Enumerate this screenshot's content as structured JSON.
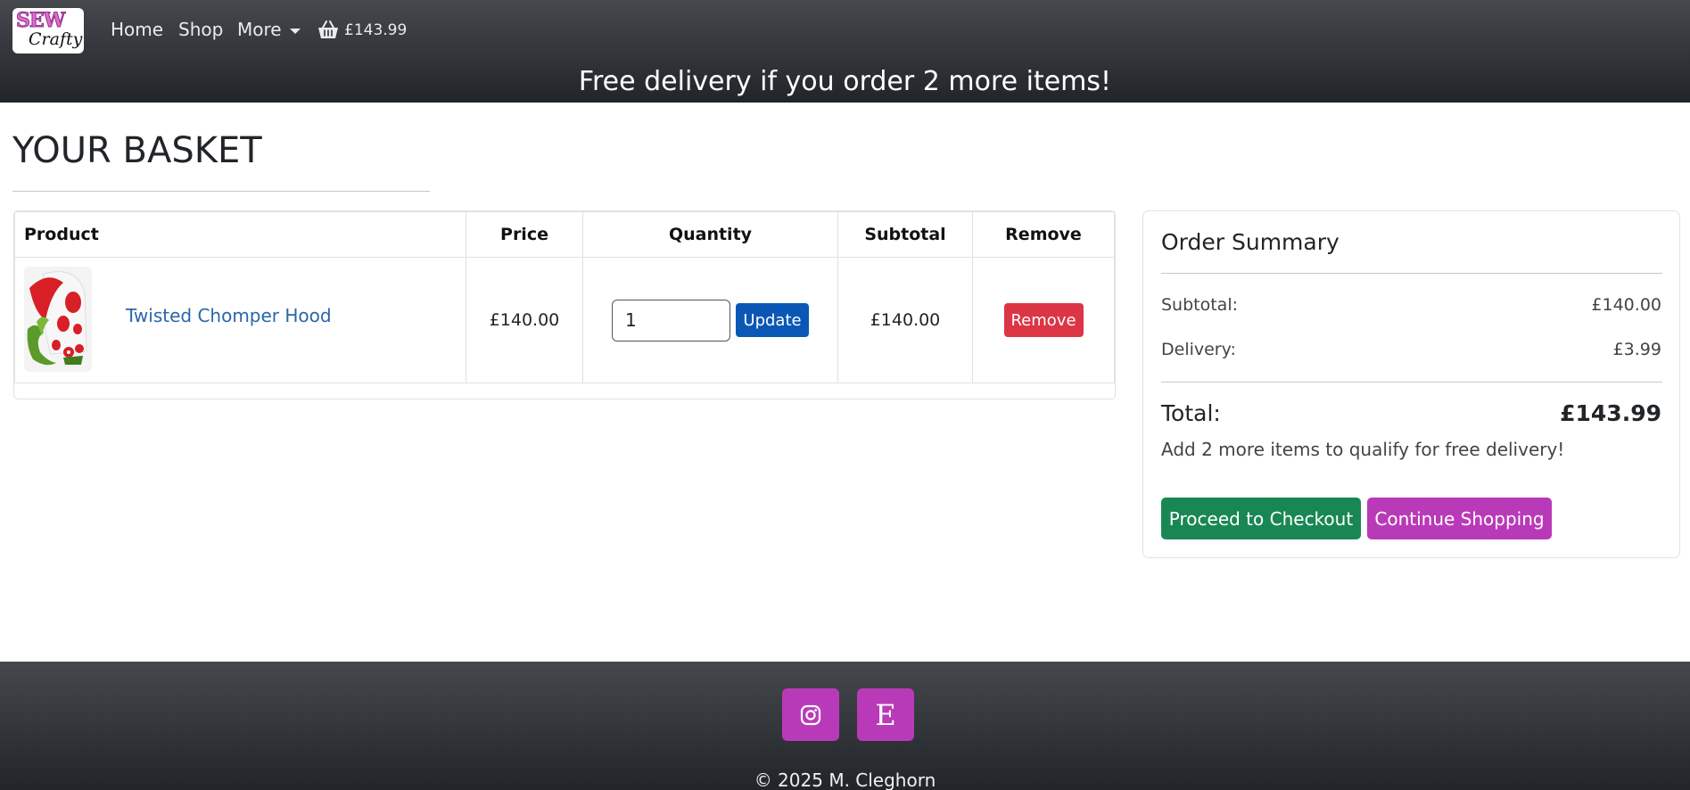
{
  "header": {
    "logo_text": {
      "top": "SEW",
      "bottom": "Crafty"
    },
    "nav": {
      "home": "Home",
      "shop": "Shop",
      "more": "More"
    },
    "basket_total": "£143.99",
    "promo": "Free delivery if you order 2 more items!"
  },
  "basket": {
    "title": "YOUR BASKET",
    "columns": {
      "product": "Product",
      "price": "Price",
      "quantity": "Quantity",
      "subtotal": "Subtotal",
      "remove": "Remove"
    },
    "items": [
      {
        "name": "Twisted Chomper Hood",
        "price": "£140.00",
        "quantity": "1",
        "update_label": "Update",
        "subtotal": "£140.00",
        "remove_label": "Remove"
      }
    ]
  },
  "summary": {
    "title": "Order Summary",
    "subtotal_label": "Subtotal:",
    "subtotal_value": "£140.00",
    "delivery_label": "Delivery:",
    "delivery_value": "£3.99",
    "total_label": "Total:",
    "total_value": "£143.99",
    "note": "Add 2 more items to qualify for free delivery!",
    "checkout_label": "Proceed to Checkout",
    "continue_label": "Continue Shopping"
  },
  "footer": {
    "etsy_letter": "E",
    "copyright": "© 2025 M. Cleghorn"
  },
  "colors": {
    "header_bg": "#212529",
    "update_button": "#0b57b6",
    "remove_button": "#dc3545",
    "checkout_button": "#198754",
    "brand_purple": "#b93ab9",
    "product_link": "#2a66a8"
  },
  "icons": {
    "basket": "basket-icon",
    "instagram": "instagram-icon",
    "etsy": "etsy-icon",
    "dropdown": "caret-down-icon"
  }
}
